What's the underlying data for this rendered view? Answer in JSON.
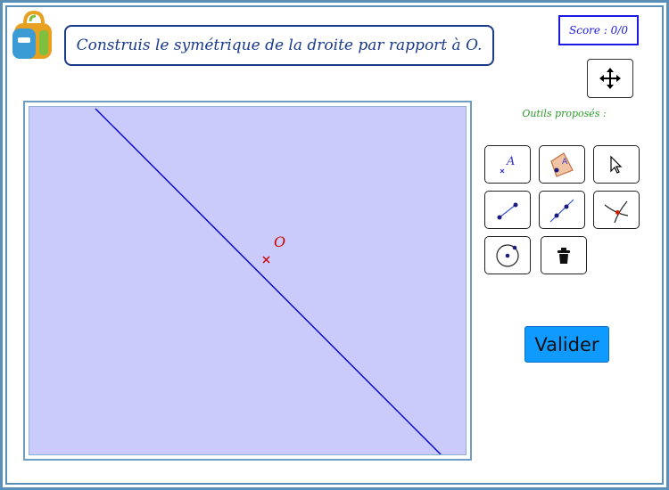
{
  "header": {
    "instruction": "Construis le symétrique de la droite par rapport à O.",
    "score": "Score : 0/0"
  },
  "canvas": {
    "point_label": "O",
    "line_color": "#0000cc",
    "point_color": "#cc0000",
    "background_color": "#cbcbfb"
  },
  "toolbar": {
    "tools_label": "Outils proposés :",
    "tools": [
      {
        "name": "point",
        "icon": "point-icon"
      },
      {
        "name": "point-on-object",
        "icon": "point-on-object-icon"
      },
      {
        "name": "move",
        "icon": "cursor-arrow-icon"
      },
      {
        "name": "segment",
        "icon": "segment-icon"
      },
      {
        "name": "line",
        "icon": "line-icon"
      },
      {
        "name": "intersection",
        "icon": "intersection-icon"
      },
      {
        "name": "circle",
        "icon": "circle-icon"
      },
      {
        "name": "delete",
        "icon": "trash-icon"
      }
    ],
    "validate_label": "Valider"
  }
}
